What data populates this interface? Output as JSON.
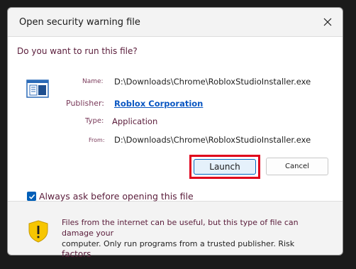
{
  "dialog": {
    "title": "Open security warning file",
    "question": "Do you want to run this file?"
  },
  "file": {
    "name_label": "Name:",
    "name_value": "D:\\Downloads\\Chrome\\RobloxStudioInstaller.exe",
    "publisher_label": "Publisher:",
    "publisher_value": "Roblox Corporation",
    "type_label": "Type:",
    "type_value": "Application",
    "from_label": "From:",
    "from_value": "D:\\Downloads\\Chrome\\RobloxStudioInstaller.exe"
  },
  "buttons": {
    "launch": "Launch",
    "cancel": "Cancel"
  },
  "checkbox": {
    "label": "Always ask before opening this file",
    "checked": true
  },
  "warning": {
    "line1": "Files from the internet can be useful, but this type of file can damage your",
    "line2": "computer. Only run programs from a trusted publisher. Risk",
    "line3": "factors"
  },
  "icons": {
    "close": "close-icon",
    "file": "application-file-icon",
    "shield": "warning-shield-icon",
    "check": "checkmark-icon"
  },
  "colors": {
    "highlight": "#e0001b",
    "accent": "#005fb8",
    "link": "#0a57c2"
  }
}
